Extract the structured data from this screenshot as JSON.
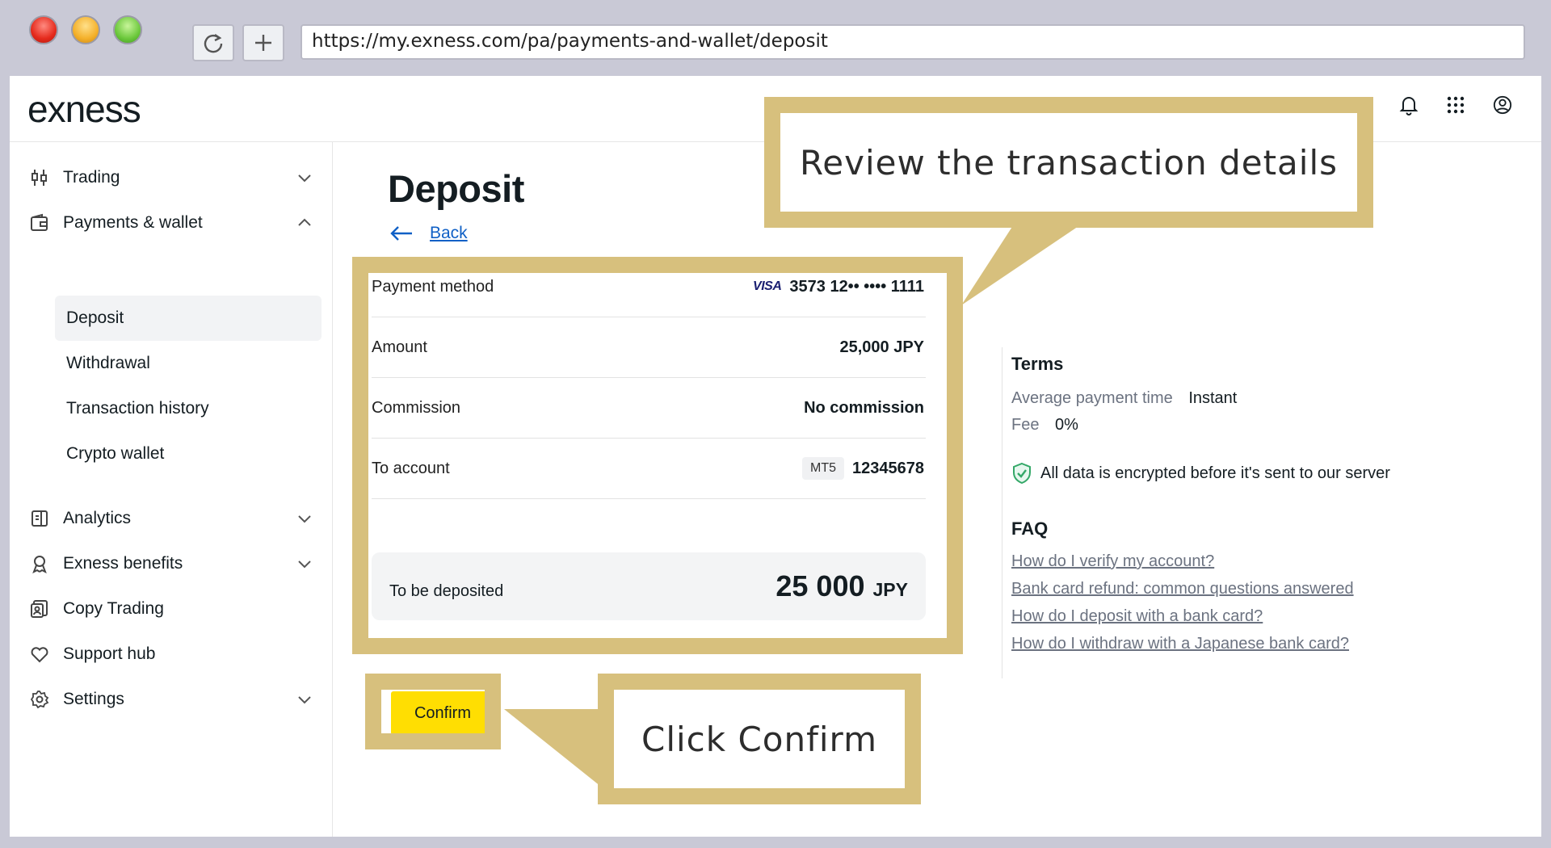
{
  "browser": {
    "url": "https://my.exness.com/pa/payments-and-wallet/deposit",
    "reload_icon": "reload-icon",
    "newtab_icon": "plus-icon"
  },
  "header": {
    "logo": "exness",
    "icons": [
      "bell-icon",
      "apps-grid-icon",
      "user-circle-icon"
    ]
  },
  "sidebar": {
    "items": [
      {
        "label": "Trading",
        "icon": "candles-icon",
        "expandable": true
      },
      {
        "label": "Payments & wallet",
        "icon": "wallet-icon",
        "expanded": true
      },
      {
        "label": "Analytics",
        "icon": "analytics-icon",
        "expandable": true
      },
      {
        "label": "Exness benefits",
        "icon": "award-icon",
        "expandable": true
      },
      {
        "label": "Copy Trading",
        "icon": "copy-trading-icon"
      },
      {
        "label": "Support hub",
        "icon": "heart-icon"
      },
      {
        "label": "Settings",
        "icon": "gear-icon",
        "expandable": true
      }
    ],
    "sub_items": [
      "Deposit",
      "Withdrawal",
      "Transaction history",
      "Crypto wallet"
    ],
    "active_sub": "Deposit"
  },
  "main": {
    "title": "Deposit",
    "back_label": "Back",
    "details": {
      "payment_method_label": "Payment method",
      "card_brand": "VISA",
      "card_number": "3573 12•• •••• 1111",
      "amount_label": "Amount",
      "amount_value": "25,000 JPY",
      "commission_label": "Commission",
      "commission_value": "No commission",
      "to_account_label": "To account",
      "account_type": "MT5",
      "account_number": "12345678"
    },
    "total": {
      "label": "To be deposited",
      "value": "25 000",
      "currency": "JPY"
    },
    "confirm_label": "Confirm"
  },
  "terms": {
    "title": "Terms",
    "avg_time_label": "Average payment time",
    "avg_time_value": "Instant",
    "fee_label": "Fee",
    "fee_value": "0%",
    "secure_text": "All data is encrypted before it's sent to our server"
  },
  "faq": {
    "title": "FAQ",
    "links": [
      "How do I verify my account?",
      "Bank card refund: common questions answered",
      "How do I deposit with a bank card?",
      "How do I withdraw with a Japanese bank card?"
    ]
  },
  "annotations": {
    "review": "Review the transaction details",
    "click": "Click Confirm",
    "callout_color": "#d7c07d"
  }
}
